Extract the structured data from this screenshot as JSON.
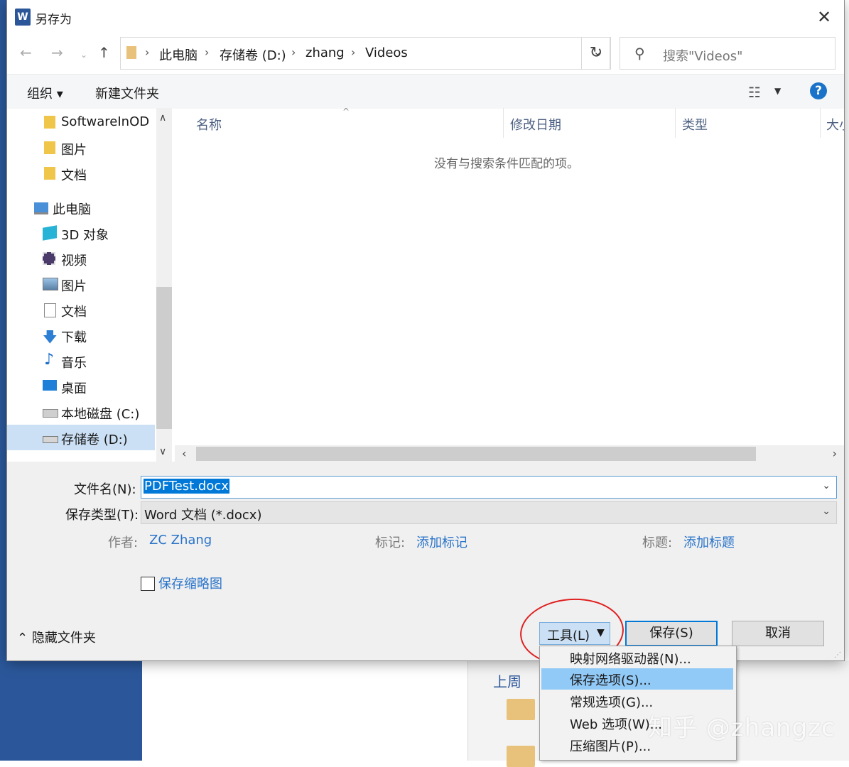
{
  "dialog": {
    "title": "另存为",
    "app_icon": "W"
  },
  "nav": {
    "back": "←",
    "forward": "→",
    "recent": "⌄",
    "up": "↑",
    "breadcrumbs": [
      "此电脑",
      "存储卷 (D:)",
      "zhang",
      "Videos"
    ],
    "refresh": "↻",
    "search_placeholder": "搜索\"Videos\""
  },
  "toolbar": {
    "organize": "组织 ▾",
    "new_folder": "新建文件夹",
    "help": "?"
  },
  "sidebar": {
    "items": [
      {
        "label": "SoftwareInOD",
        "icon": "folder-icon"
      },
      {
        "label": "图片",
        "icon": "folder-icon"
      },
      {
        "label": "文档",
        "icon": "folder-icon"
      },
      {
        "label": "此电脑",
        "icon": "computer-icon"
      },
      {
        "label": "3D 对象",
        "icon": "cube-icon"
      },
      {
        "label": "视频",
        "icon": "video-icon"
      },
      {
        "label": "图片",
        "icon": "picture-icon"
      },
      {
        "label": "文档",
        "icon": "document-icon"
      },
      {
        "label": "下载",
        "icon": "download-icon"
      },
      {
        "label": "音乐",
        "icon": "music-icon"
      },
      {
        "label": "桌面",
        "icon": "desktop-icon"
      },
      {
        "label": "本地磁盘 (C:)",
        "icon": "drive-icon"
      },
      {
        "label": "存储卷 (D:)",
        "icon": "drive-icon",
        "selected": true
      }
    ]
  },
  "filelist": {
    "columns": [
      "名称",
      "修改日期",
      "类型",
      "大小"
    ],
    "empty_message": "没有与搜索条件匹配的项。"
  },
  "form": {
    "filename_label": "文件名(N):",
    "filename_value": "PDFTest.docx",
    "type_label": "保存类型(T):",
    "type_value": "Word 文档 (*.docx)",
    "author_label": "作者:",
    "author_value": "ZC Zhang",
    "tags_label": "标记:",
    "tags_value": "添加标记",
    "title_label": "标题:",
    "title_value": "添加标题",
    "thumbnail_label": "保存缩略图",
    "thumbnail_checked": false
  },
  "footer": {
    "hide_folders": "隐藏文件夹",
    "tools": "工具(L)",
    "save": "保存(S)",
    "cancel": "取消"
  },
  "tools_menu": {
    "items": [
      "映射网络驱动器(N)...",
      "保存选项(S)...",
      "常规选项(G)...",
      "Web 选项(W)...",
      "压缩图片(P)..."
    ],
    "highlighted_index": 1
  },
  "background": {
    "section_label": "上周"
  },
  "watermark": "知乎 @zhangzc",
  "colors": {
    "accent": "#0078d7",
    "word_blue": "#2b579a",
    "link": "#2a74c9",
    "annotation": "#e02020",
    "menu_highlight": "#91c9f7"
  }
}
